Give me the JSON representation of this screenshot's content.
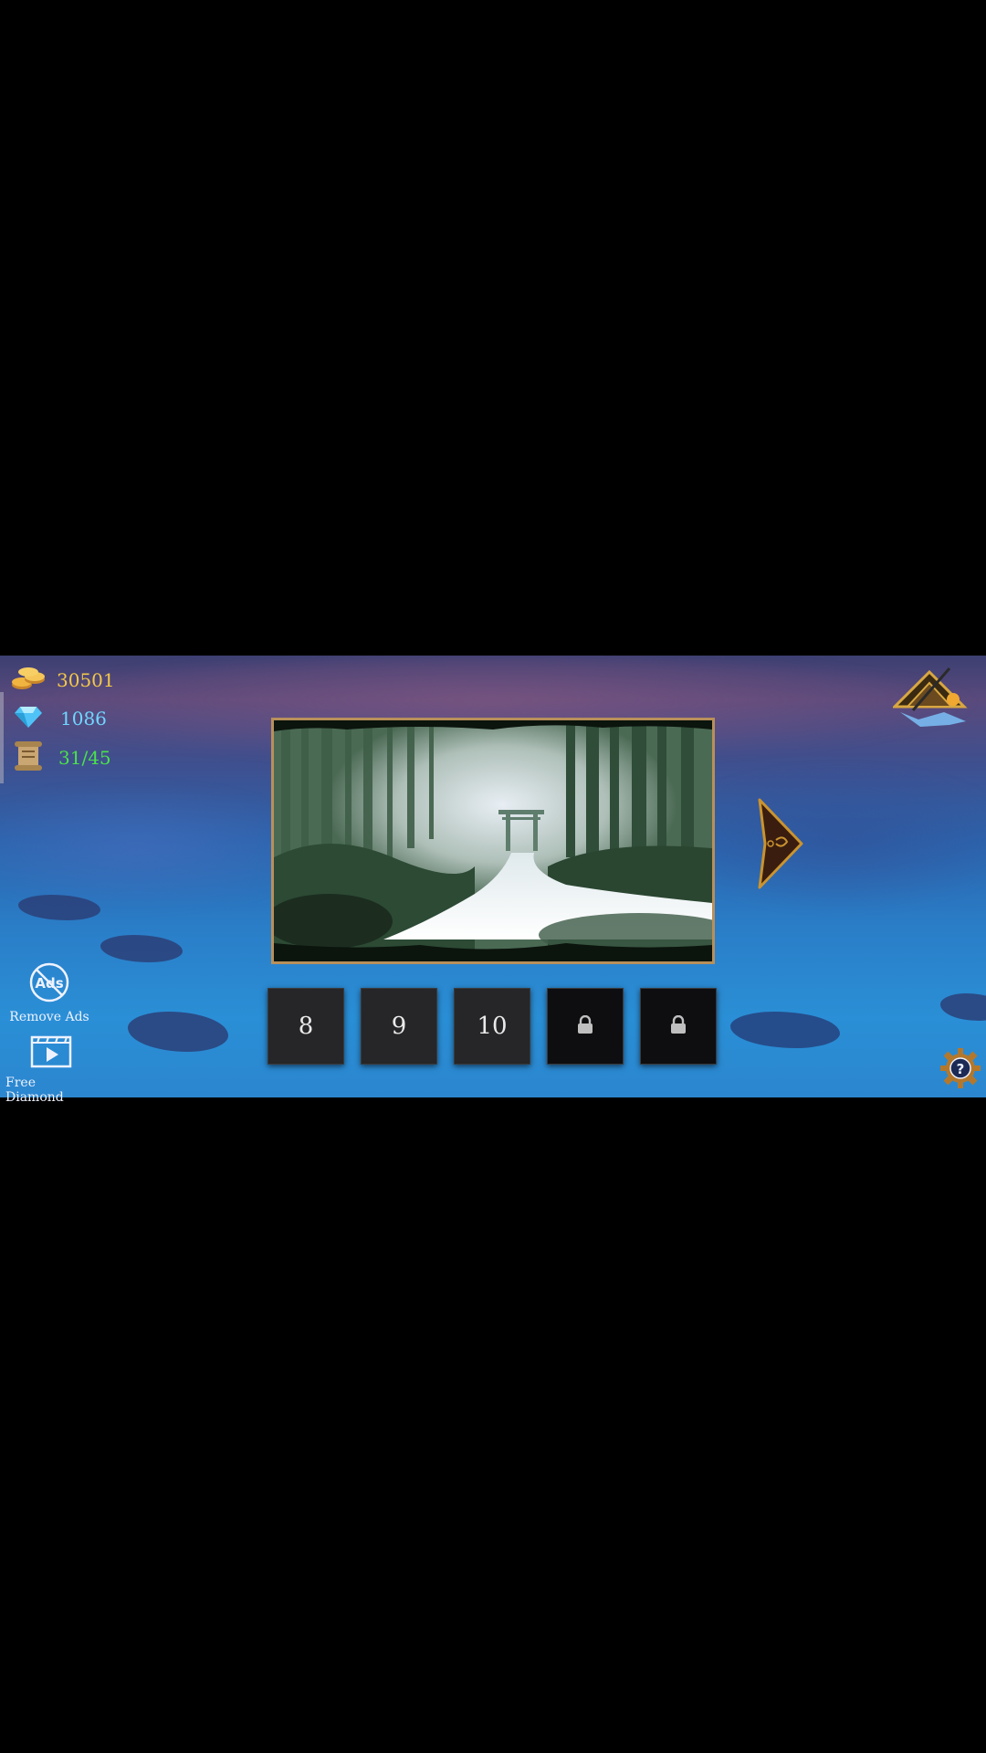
{
  "hud": {
    "coins": {
      "icon": "coin-stack-icon",
      "value": "30501"
    },
    "diamonds": {
      "icon": "diamond-icon",
      "value": "1086"
    },
    "scrolls": {
      "icon": "scroll-icon",
      "value": "31/45"
    }
  },
  "side_buttons": {
    "remove_ads": {
      "icon": "no-ads-icon",
      "icon_text": "Ads",
      "label": "Remove Ads"
    },
    "free_diamond": {
      "icon": "video-play-icon",
      "label": "Free Diamond"
    }
  },
  "scene": {
    "image": "bamboo-forest-gate-scene"
  },
  "levels": [
    {
      "label": "8",
      "locked": false
    },
    {
      "label": "9",
      "locked": false
    },
    {
      "label": "10",
      "locked": false
    },
    {
      "label": "",
      "locked": true,
      "icon": "lock-icon"
    },
    {
      "label": "",
      "locked": true,
      "icon": "lock-icon"
    }
  ],
  "navigation": {
    "next_icon": "next-arrow-icon"
  },
  "settings": {
    "icon": "gear-help-icon"
  },
  "colors": {
    "coins": "#f3c84a",
    "diamonds": "#6fd7ff",
    "scrolls": "#4be24b",
    "frame": "#b8905a"
  }
}
